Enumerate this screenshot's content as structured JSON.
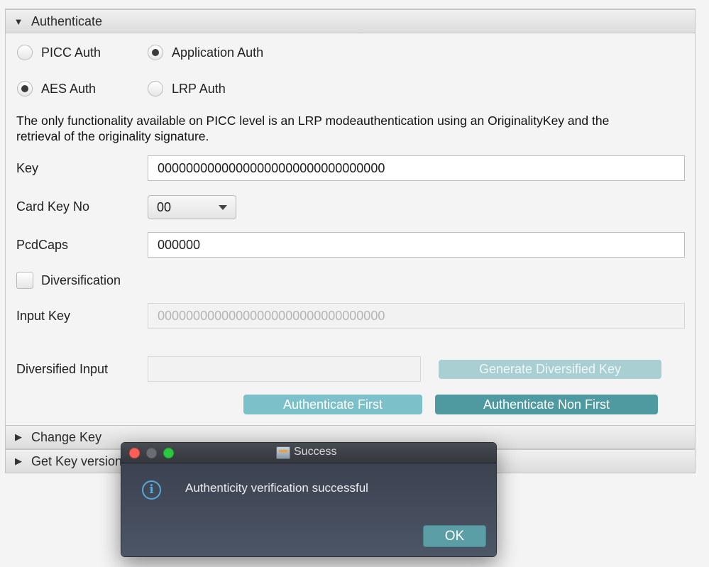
{
  "sections": {
    "authenticate": "Authenticate",
    "change_key": "Change Key",
    "get_key_version": "Get Key version"
  },
  "auth_type": {
    "picc": "PICC Auth",
    "application": "Application Auth",
    "selected": "Application Auth"
  },
  "auth_mode": {
    "aes": "AES Auth",
    "lrp": "LRP Auth",
    "selected": "AES Auth"
  },
  "description_line1": "The only functionality available on PICC level is an LRP modeauthentication using an OriginalityKey and the",
  "description_line2": "retrieval of the originality signature.",
  "form": {
    "key_label": "Key",
    "key_value": "00000000000000000000000000000000",
    "card_key_no_label": "Card Key No",
    "card_key_no_value": "00",
    "pcdcaps_label": "PcdCaps",
    "pcdcaps_value": "000000",
    "diversification_label": "Diversification",
    "input_key_label": "Input Key",
    "input_key_value": "00000000000000000000000000000000",
    "diversified_input_label": "Diversified Input",
    "diversified_input_value": ""
  },
  "buttons": {
    "generate": "Generate Diversified Key",
    "auth_first": "Authenticate First",
    "auth_non_first": "Authenticate Non First"
  },
  "dialog": {
    "title": "Success",
    "message": "Authenticity verification successful",
    "ok": "OK"
  },
  "colors": {
    "teal_light": "#7cc1c9",
    "teal_dark": "#4f9aa0",
    "teal_disabled": "#a9cfd3"
  }
}
